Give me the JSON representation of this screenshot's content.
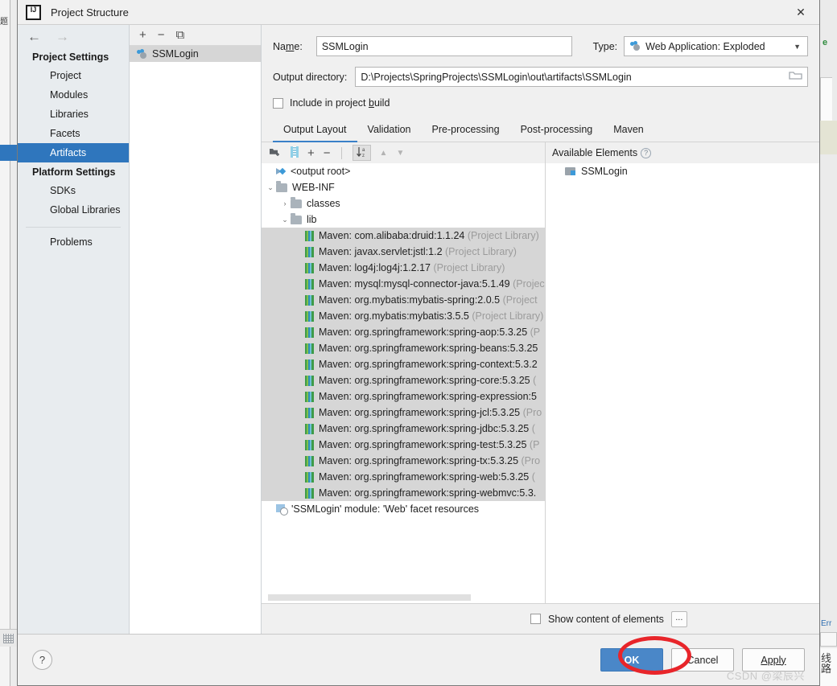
{
  "window": {
    "title": "Project Structure",
    "logo_alt": "intellij-idea-logo",
    "close_label": "✕"
  },
  "nav": {
    "back_icon": "←",
    "forward_icon": "→",
    "groups": [
      {
        "label": "Project Settings",
        "items": [
          {
            "label": "Project",
            "selected": false
          },
          {
            "label": "Modules",
            "selected": false
          },
          {
            "label": "Libraries",
            "selected": false
          },
          {
            "label": "Facets",
            "selected": false
          },
          {
            "label": "Artifacts",
            "selected": true
          }
        ]
      },
      {
        "label": "Platform Settings",
        "items": [
          {
            "label": "SDKs",
            "selected": false
          },
          {
            "label": "Global Libraries",
            "selected": false
          }
        ]
      }
    ],
    "extra_item": "Problems",
    "selected_item": "Artifacts",
    "selection_color": "#2f76bd"
  },
  "artifacts_panel": {
    "toolbar": {
      "add": "+",
      "remove": "−",
      "copy": "⧉"
    },
    "items": [
      {
        "label": "SSMLogin",
        "selected": true
      }
    ]
  },
  "form": {
    "name_label": "Name:",
    "name_value": "SSMLogin",
    "type_label": "Type:",
    "type_value": "Web Application: Exploded",
    "type_caret": "▼",
    "output_dir_label": "Output directory:",
    "output_dir_value": "D:\\Projects\\SpringProjects\\SSMLogin\\out\\artifacts\\SSMLogin",
    "browse_icon": "🗀",
    "include_in_build_label": "Include in project build",
    "include_in_build_checked": false
  },
  "tabs": {
    "items": [
      {
        "label": "Output Layout",
        "active": true
      },
      {
        "label": "Validation",
        "active": false
      },
      {
        "label": "Pre-processing",
        "active": false
      },
      {
        "label": "Post-processing",
        "active": false
      },
      {
        "label": "Maven",
        "active": false
      }
    ],
    "active_underline_color": "#3a80c8"
  },
  "tree_toolbar": {
    "add_dir_icon": "◰",
    "add_archive_icon": "⬛",
    "add_icon": "+",
    "remove_icon": "−",
    "sort_icon": "↓ᵃᴢ",
    "up_icon": "▲",
    "down_icon": "▼"
  },
  "tree": {
    "nodes": [
      {
        "label": "<output root>",
        "indent": 0,
        "icon": "output-root",
        "twist": "",
        "selected": false,
        "suffix": ""
      },
      {
        "label": "WEB-INF",
        "indent": 0,
        "icon": "folder",
        "twist": "⌄",
        "selected": false,
        "suffix": ""
      },
      {
        "label": "classes",
        "indent": 1,
        "icon": "folder",
        "twist": "›",
        "selected": false,
        "suffix": ""
      },
      {
        "label": "lib",
        "indent": 1,
        "icon": "folder",
        "twist": "⌄",
        "selected": false,
        "suffix": ""
      },
      {
        "label": "Maven: com.alibaba:druid:1.1.24",
        "indent": 2,
        "icon": "jar",
        "twist": "",
        "selected": true,
        "suffix": "(Project Library)"
      },
      {
        "label": "Maven: javax.servlet:jstl:1.2",
        "indent": 2,
        "icon": "jar",
        "twist": "",
        "selected": true,
        "suffix": "(Project Library)"
      },
      {
        "label": "Maven: log4j:log4j:1.2.17",
        "indent": 2,
        "icon": "jar",
        "twist": "",
        "selected": true,
        "suffix": "(Project Library)"
      },
      {
        "label": "Maven: mysql:mysql-connector-java:5.1.49",
        "indent": 2,
        "icon": "jar",
        "twist": "",
        "selected": true,
        "suffix": "(Projec"
      },
      {
        "label": "Maven: org.mybatis:mybatis-spring:2.0.5",
        "indent": 2,
        "icon": "jar",
        "twist": "",
        "selected": true,
        "suffix": "(Project"
      },
      {
        "label": "Maven: org.mybatis:mybatis:3.5.5",
        "indent": 2,
        "icon": "jar",
        "twist": "",
        "selected": true,
        "suffix": "(Project Library)"
      },
      {
        "label": "Maven: org.springframework:spring-aop:5.3.25",
        "indent": 2,
        "icon": "jar",
        "twist": "",
        "selected": true,
        "suffix": "(P"
      },
      {
        "label": "Maven: org.springframework:spring-beans:5.3.25",
        "indent": 2,
        "icon": "jar",
        "twist": "",
        "selected": true,
        "suffix": ""
      },
      {
        "label": "Maven: org.springframework:spring-context:5.3.2",
        "indent": 2,
        "icon": "jar",
        "twist": "",
        "selected": true,
        "suffix": ""
      },
      {
        "label": "Maven: org.springframework:spring-core:5.3.25",
        "indent": 2,
        "icon": "jar",
        "twist": "",
        "selected": true,
        "suffix": "("
      },
      {
        "label": "Maven: org.springframework:spring-expression:5",
        "indent": 2,
        "icon": "jar",
        "twist": "",
        "selected": true,
        "suffix": ""
      },
      {
        "label": "Maven: org.springframework:spring-jcl:5.3.25",
        "indent": 2,
        "icon": "jar",
        "twist": "",
        "selected": true,
        "suffix": "(Pro"
      },
      {
        "label": "Maven: org.springframework:spring-jdbc:5.3.25",
        "indent": 2,
        "icon": "jar",
        "twist": "",
        "selected": true,
        "suffix": "("
      },
      {
        "label": "Maven: org.springframework:spring-test:5.3.25",
        "indent": 2,
        "icon": "jar",
        "twist": "",
        "selected": true,
        "suffix": "(P"
      },
      {
        "label": "Maven: org.springframework:spring-tx:5.3.25",
        "indent": 2,
        "icon": "jar",
        "twist": "",
        "selected": true,
        "suffix": "(Pro"
      },
      {
        "label": "Maven: org.springframework:spring-web:5.3.25",
        "indent": 2,
        "icon": "jar",
        "twist": "",
        "selected": true,
        "suffix": "("
      },
      {
        "label": "Maven: org.springframework:spring-webmvc:5.3.",
        "indent": 2,
        "icon": "jar",
        "twist": "",
        "selected": true,
        "suffix": ""
      },
      {
        "label": "'SSMLogin' module: 'Web' facet resources",
        "indent": 0,
        "icon": "facet",
        "twist": "",
        "selected": false,
        "suffix": ""
      }
    ]
  },
  "available": {
    "header_label": "Available Elements",
    "help_icon": "?",
    "items": [
      {
        "label": "SSMLogin"
      }
    ]
  },
  "options": {
    "show_content_label": "Show content of elements",
    "show_content_checked": false,
    "more_button_label": "..."
  },
  "footer": {
    "help_label": "?",
    "ok_label": "OK",
    "cancel_label": "Cancel",
    "apply_label": "Apply",
    "ok_color": "#4a87c8",
    "annotation_color": "#e8252a"
  },
  "watermark": {
    "text": "CSDN @梁辰兴"
  },
  "backdrop": {
    "left_cjk": "题",
    "right_cjk": "线路",
    "green_text": "e",
    "error_text": "Err"
  }
}
